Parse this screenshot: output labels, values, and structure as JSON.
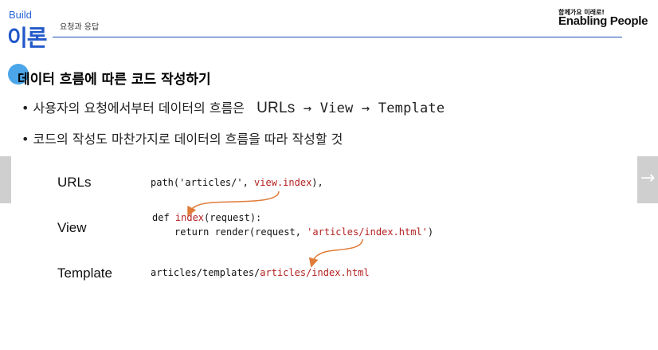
{
  "header": {
    "category": "Build",
    "title": "이론",
    "subtitle": "요청과 응답",
    "brand_tagline": "함께가요 미래로!",
    "brand_name": "Enabling People"
  },
  "section": {
    "title": "데이터 흐름에 따른 코드 작성하기"
  },
  "bullets": [
    {
      "prefix": "• 사용자의 요청에서부터 데이터의 흐름은",
      "flow_urls": "URLs",
      "flow_rest": " → View → Template"
    },
    {
      "text": "• 코드의 작성도 마찬가지로 데이터의 흐름을 따라 작성할 것"
    }
  ],
  "diagram": {
    "labels": {
      "urls": "URLs",
      "view": "View",
      "template": "Template"
    },
    "code_urls": {
      "a": "path('articles/', ",
      "b": "view.index",
      "c": "),"
    },
    "code_view_def": {
      "a": "def ",
      "b": "index",
      "c": "(request):"
    },
    "code_view_return": {
      "a": "return render(request, ",
      "b": "'articles/index.html'",
      "c": ")"
    },
    "code_template": {
      "a": "articles/templates/",
      "b": "articles/index.html"
    }
  },
  "nav": {
    "next_icon": "arrow-right-icon",
    "next_glyph": "→"
  },
  "colors": {
    "accent_blue": "#2258c9",
    "dot_blue": "#4aa6e8",
    "code_red": "#b42020",
    "arrow_orange": "#e07b39"
  }
}
